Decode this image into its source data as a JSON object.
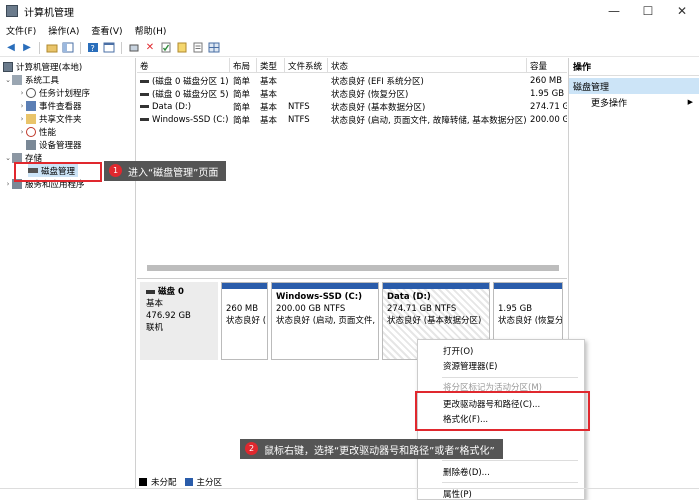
{
  "window": {
    "title": "计算机管理",
    "controls": [
      "—",
      "☐",
      "✕"
    ]
  },
  "menu": [
    "文件(F)",
    "操作(A)",
    "查看(V)",
    "帮助(H)"
  ],
  "tree": {
    "root": "计算机管理(本地)",
    "system_tools": "系统工具",
    "task_scheduler": "任务计划程序",
    "event_viewer": "事件查看器",
    "shared_folders": "共享文件夹",
    "performance": "性能",
    "device_manager": "设备管理器",
    "storage": "存储",
    "disk_management": "磁盘管理",
    "services": "服务和应用程序"
  },
  "volume_list": {
    "headers": [
      "卷",
      "布局",
      "类型",
      "文件系统",
      "状态",
      "容量"
    ],
    "rows": [
      [
        "(磁盘 0 磁盘分区 1)",
        "简单",
        "基本",
        "",
        "状态良好 (EFI 系统分区)",
        "260 MB"
      ],
      [
        "(磁盘 0 磁盘分区 5)",
        "简单",
        "基本",
        "",
        "状态良好 (恢复分区)",
        "1.95 GB"
      ],
      [
        "Data (D:)",
        "简单",
        "基本",
        "NTFS",
        "状态良好 (基本数据分区)",
        "274.71 G"
      ],
      [
        "Windows-SSD (C:)",
        "简单",
        "基本",
        "NTFS",
        "状态良好 (启动, 页面文件, 故障转储, 基本数据分区)",
        "200.00 G"
      ]
    ]
  },
  "disk": {
    "name": "磁盘 0",
    "type": "基本",
    "size": "476.92 GB",
    "status": "联机",
    "partitions": [
      {
        "name": "",
        "size": "260 MB",
        "status": "状态良好 ("
      },
      {
        "name": "Windows-SSD  (C:)",
        "size": "200.00 GB NTFS",
        "status": "状态良好 (启动, 页面文件,"
      },
      {
        "name": "Data  (D:)",
        "size": "274.71 GB NTFS",
        "status": "状态良好 (基本数据分区)"
      },
      {
        "name": "",
        "size": "1.95 GB",
        "status": "状态良好 (恢复分"
      }
    ]
  },
  "legend": {
    "unallocated": "未分配",
    "primary": "主分区"
  },
  "actions": {
    "header": "操作",
    "selected": "磁盘管理",
    "more": "更多操作"
  },
  "context_menu": {
    "open": "打开(O)",
    "explore": "资源管理器(E)",
    "mark_active": "将分区标记为活动分区(M)",
    "change_letter": "更改驱动器号和路径(C)...",
    "format": "格式化(F)...",
    "delete": "删除卷(D)...",
    "properties": "属性(P)"
  },
  "callouts": {
    "one": {
      "num": "1",
      "text": "进入“磁盘管理”页面"
    },
    "two": {
      "num": "2",
      "text": "鼠标右键，选择“更改驱动器号和路径”或者“格式化”"
    }
  },
  "colors": {
    "accent_red": "#e0282e",
    "primary_partition": "#2a5caa",
    "selection": "#cce4f7"
  }
}
